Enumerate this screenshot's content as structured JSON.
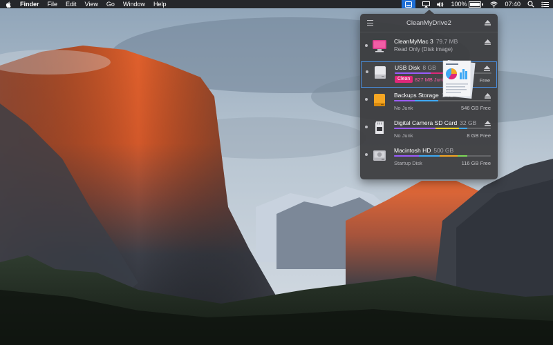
{
  "menubar": {
    "app_name": "Finder",
    "menus": [
      "File",
      "Edit",
      "View",
      "Go",
      "Window",
      "Help"
    ],
    "battery_percent": "100%",
    "battery_level": 1.0,
    "time": "07:40"
  },
  "popup": {
    "title": "CleanMyDrive2",
    "drives": [
      {
        "name": "CleanMyMac 3",
        "capacity": "79.7 MB",
        "subtitle": "Read Only (Disk image)",
        "icon": "cleanmymac-disk-icon"
      },
      {
        "name": "USB Disk",
        "capacity": "8 GB",
        "badge": "Clean",
        "junk": "827 MB Junk",
        "free": "Free",
        "icon": "usb-disk-icon",
        "selected": true
      },
      {
        "name": "Backups Storage",
        "capacity": "1 TB",
        "status": "No Junk",
        "free": "546 GB Free",
        "icon": "external-drive-icon"
      },
      {
        "name": "Digital Camera SD Card",
        "capacity": "32 GB",
        "status": "No Junk",
        "free": "8 GB Free",
        "icon": "sd-card-icon"
      },
      {
        "name": "Macintosh HD",
        "capacity": "500 GB",
        "status": "Startup Disk",
        "free": "116 GB Free",
        "icon": "internal-drive-icon"
      }
    ]
  },
  "colors": {
    "accent_blue": "#1f6fd6",
    "selection_border": "#4a90e2",
    "clean_badge": "#e0287a",
    "junk_text": "#ff5aa5"
  }
}
